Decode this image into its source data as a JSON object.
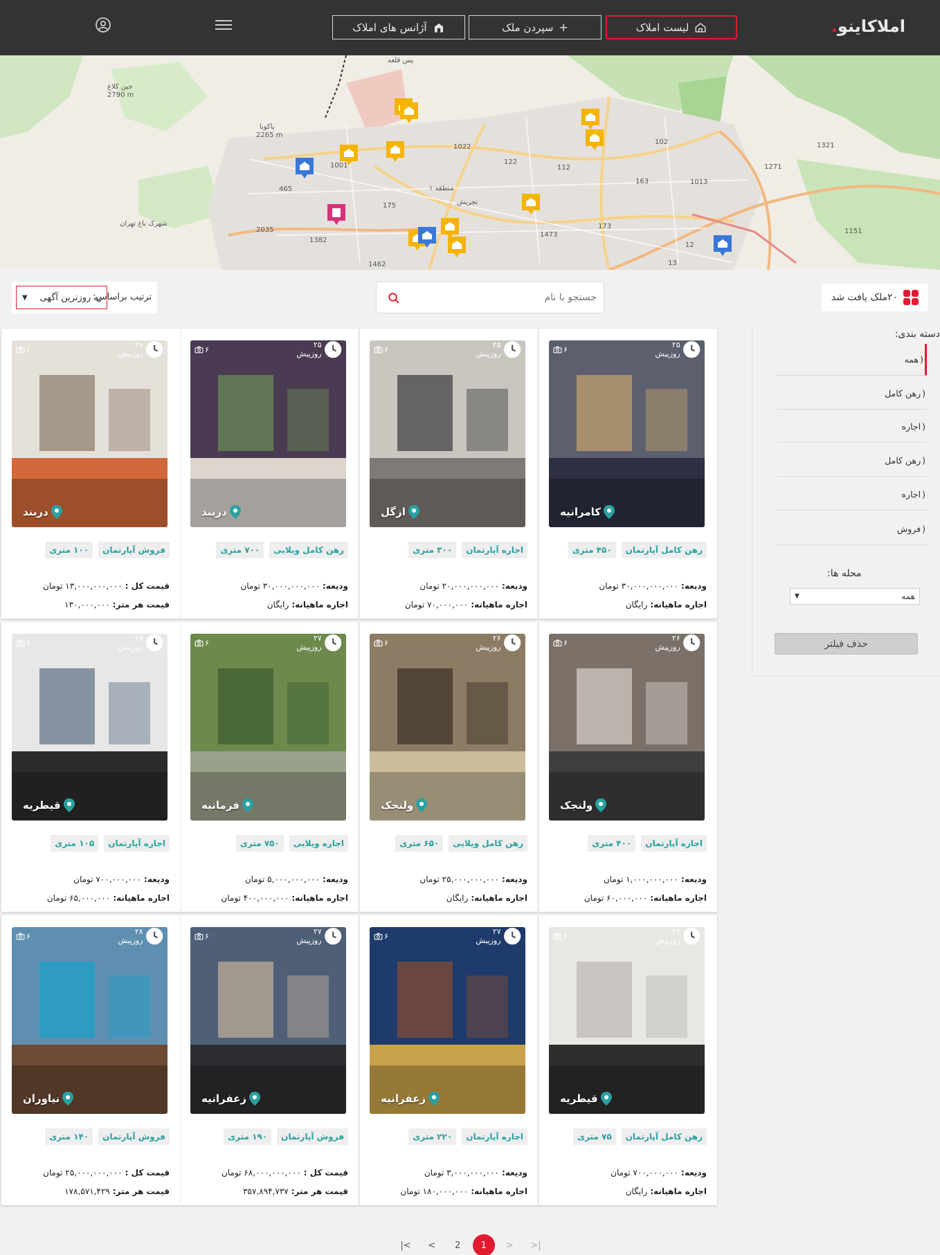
{
  "brand": {
    "name": "املاکاینو",
    "accent": "#e01b2f",
    "dark": "#333333",
    "tag_color": "#2aa1a1"
  },
  "nav": {
    "list_label": "لیست املاک",
    "submit_label": "سپردن ملک",
    "agencies_label": "آژانس های املاک"
  },
  "map": {
    "labels": [
      "جین کلاغ 2790 m",
      "پاکوبا 2265 m",
      "شهرک باغ تهران",
      "منطقه ۱",
      "تجریش",
      "پس قلعه",
      "1022",
      "122",
      "112",
      "102",
      "1321",
      "1271",
      "1013",
      "163",
      "175",
      "173",
      "1473",
      "465",
      "2035",
      "1382",
      "1462",
      "1151",
      "13",
      "12",
      "1001"
    ]
  },
  "toolbar": {
    "found_text": "۲۰ملک یافت شد",
    "search_placeholder": "جستجو با نام",
    "sort_label": "ترتیب براساس:",
    "sort_value": "به روزترین آگهی"
  },
  "sidebar": {
    "title": "دسته بندی:",
    "categories": [
      "همه",
      "رهن کامل",
      "اجاره",
      "رهن کامل",
      "اجاره",
      "فروش"
    ],
    "hood_label": "محله ها:",
    "hood_value": "همه",
    "clear_label": "حذف فیلتر"
  },
  "cards": [
    {
      "time": "۲۵ روزپیش",
      "photos": "۶",
      "loc": "کامرانیه",
      "type": "رهن کامل آپارتمان",
      "area": "۴۵۰ متری",
      "l1k": "ودیعه:",
      "l1v": "۳۰,۰۰۰,۰۰۰,۰۰۰ تومان",
      "l2k": "اجاره ماهیانه:",
      "l2v": "رایگان"
    },
    {
      "time": "۲۵ روزپیش",
      "photos": "۶",
      "loc": "ازگل",
      "type": "اجاره آپارتمان",
      "area": "۳۰۰ متری",
      "l1k": "ودیعه:",
      "l1v": "۲۰,۰۰۰,۰۰۰,۰۰۰ تومان",
      "l2k": "اجاره ماهیانه:",
      "l2v": "۷۰,۰۰۰,۰۰۰ تومان"
    },
    {
      "time": "۲۵ روزپیش",
      "photos": "۶",
      "loc": "دربند",
      "type": "رهن کامل ویلایی",
      "area": "۷۰۰ متری",
      "l1k": "ودیعه:",
      "l1v": "۳۰,۰۰۰,۰۰۰,۰۰۰ تومان",
      "l2k": "اجاره ماهیانه:",
      "l2v": "رایگان"
    },
    {
      "time": "۲۶ روزپیش",
      "photos": "۶",
      "loc": "دربند",
      "type": "فروش آپارتمان",
      "area": "۱۰۰ متری",
      "l1k": "قیمت کل :",
      "l1v": "۱۳,۰۰۰,۰۰۰,۰۰۰ تومان",
      "l2k": "قیمت هر متر:",
      "l2v": "۱۳۰,۰۰۰,۰۰۰"
    },
    {
      "time": "۲۶ روزپیش",
      "photos": "۶",
      "loc": "ولنجک",
      "type": "اجاره آپارتمان",
      "area": "۴۰۰ متری",
      "l1k": "ودیعه:",
      "l1v": "۱,۰۰۰,۰۰۰,۰۰۰ تومان",
      "l2k": "اجاره ماهیانه:",
      "l2v": "۶۰,۰۰۰,۰۰۰ تومان"
    },
    {
      "time": "۲۶ روزپیش",
      "photos": "۶",
      "loc": "ولنجک",
      "type": "رهن کامل ویلایی",
      "area": "۶۵۰ متری",
      "l1k": "ودیعه:",
      "l1v": "۲۵,۰۰۰,۰۰۰,۰۰۰ تومان",
      "l2k": "اجاره ماهیانه:",
      "l2v": "رایگان"
    },
    {
      "time": "۲۷ روزپیش",
      "photos": "۶",
      "loc": "فرمانیه",
      "type": "اجاره ویلایی",
      "area": "۷۵۰ متری",
      "l1k": "ودیعه:",
      "l1v": "۵,۰۰۰,۰۰۰,۰۰۰ تومان",
      "l2k": "اجاره ماهیانه:",
      "l2v": "۴۰۰,۰۰۰,۰۰۰ تومان"
    },
    {
      "time": "۲۷ روزپیش",
      "photos": "۶",
      "loc": "قیطریه",
      "type": "اجاره آپارتمان",
      "area": "۱۰۵ متری",
      "l1k": "ودیعه:",
      "l1v": "۷۰۰,۰۰۰,۰۰۰ تومان",
      "l2k": "اجاره ماهیانه:",
      "l2v": "۶۵,۰۰۰,۰۰۰ تومان"
    },
    {
      "time": "۲۷ روزپیش",
      "photos": "۶",
      "loc": "قیطریه",
      "type": "رهن کامل آپارتمان",
      "area": "۷۵ متری",
      "l1k": "ودیعه:",
      "l1v": "۷۰۰,۰۰۰,۰۰۰ تومان",
      "l2k": "اجاره ماهیانه:",
      "l2v": "رایگان"
    },
    {
      "time": "۲۷ روزپیش",
      "photos": "۶",
      "loc": "زعفرانیه",
      "type": "اجاره آپارتمان",
      "area": "۲۲۰ متری",
      "l1k": "ودیعه:",
      "l1v": "۳,۰۰۰,۰۰۰,۰۰۰ تومان",
      "l2k": "اجاره ماهیانه:",
      "l2v": "۱۸۰,۰۰۰,۰۰۰ تومان"
    },
    {
      "time": "۲۷ روزپیش",
      "photos": "۶",
      "loc": "زعفرانیه",
      "type": "فروش آپارتمان",
      "area": "۱۹۰ متری",
      "l1k": "قیمت کل :",
      "l1v": "۶۸,۰۰۰,۰۰۰,۰۰۰ تومان",
      "l2k": "قیمت هر متر:",
      "l2v": "۳۵۷,۸۹۴,۷۳۷"
    },
    {
      "time": "۲۸ روزپیش",
      "photos": "۶",
      "loc": "نیاوران",
      "type": "فروش آپارتمان",
      "area": "۱۴۰ متری",
      "l1k": "قیمت کل :",
      "l1v": "۲۵,۰۰۰,۰۰۰,۰۰۰ تومان",
      "l2k": "قیمت هر متر:",
      "l2v": "۱۷۸,۵۷۱,۴۲۹"
    }
  ],
  "pager": {
    "first": "|<",
    "prev": "<",
    "page2": "2",
    "page1": "1",
    "next": ">",
    "last": ">|"
  }
}
